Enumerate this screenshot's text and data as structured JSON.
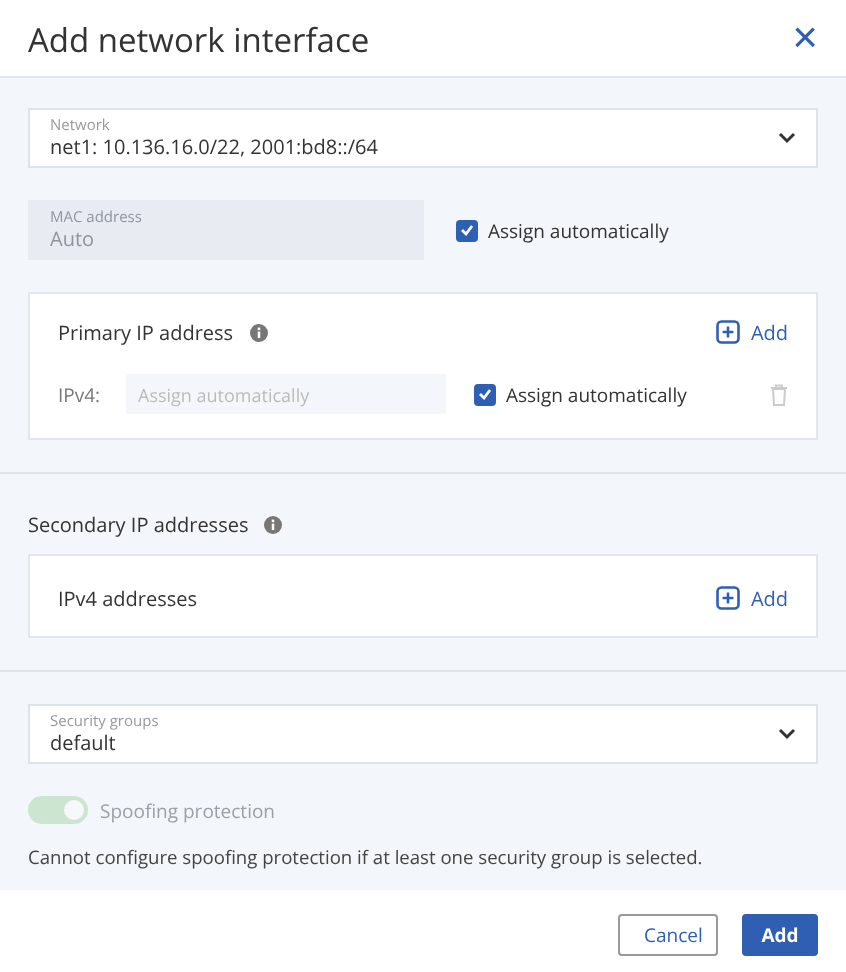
{
  "dialog": {
    "title": "Add network interface",
    "close": "×"
  },
  "network": {
    "label": "Network",
    "value": "net1: 10.136.16.0/22, 2001:bd8::/64"
  },
  "mac": {
    "label": "MAC address",
    "value": "Auto",
    "disabled": true,
    "assign_label": "Assign automatically",
    "assign_checked": true
  },
  "primary": {
    "title": "Primary IP address",
    "add": "Add",
    "rows": [
      {
        "label": "IPv4:",
        "placeholder": "Assign automatically",
        "assign_label": "Assign automatically",
        "assign_checked": true
      }
    ]
  },
  "secondary": {
    "title": "Secondary IP addresses",
    "card_title": "IPv4 addresses",
    "add": "Add"
  },
  "security_groups": {
    "label": "Security groups",
    "value": "default"
  },
  "spoofing": {
    "label": "Spoofing protection",
    "on": true,
    "disabled": true,
    "note": "Cannot configure spoofing protection if at least one security group is selected."
  },
  "buttons": [
    {
      "label": "Cancel",
      "kind": "secondary"
    },
    {
      "label": "Add",
      "kind": "primary"
    }
  ]
}
